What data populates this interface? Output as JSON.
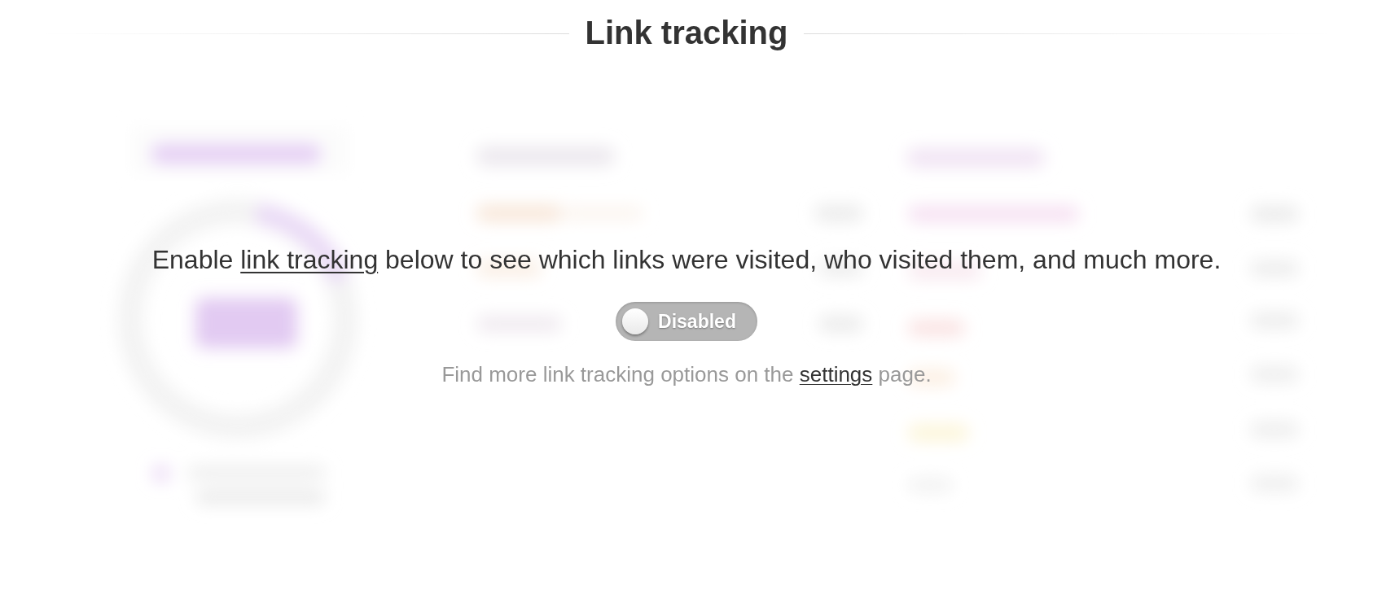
{
  "header": {
    "title": "Link tracking"
  },
  "intro": {
    "before": "Enable ",
    "link": "link tracking",
    "after": " below to see which links were visited, who visited them, and much more."
  },
  "toggle": {
    "label": "Disabled",
    "on": false
  },
  "note": {
    "before": "Find more link tracking options on the ",
    "link": "settings",
    "after": " page."
  }
}
